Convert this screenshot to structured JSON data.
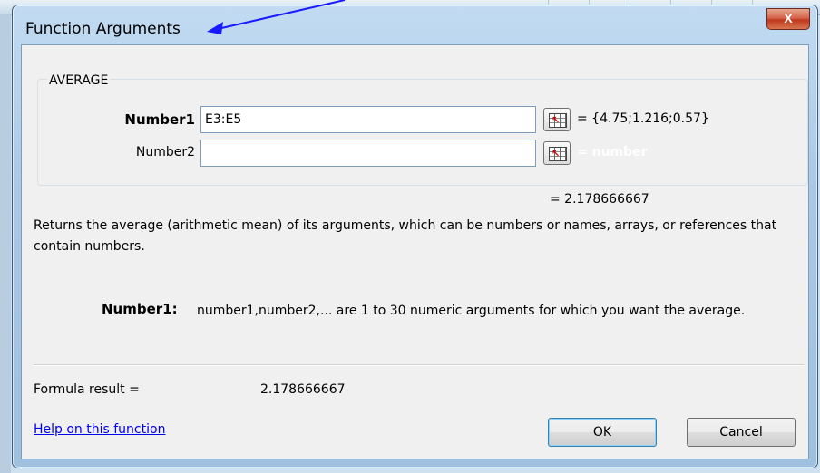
{
  "window": {
    "title": "Function Arguments",
    "close_label": "X"
  },
  "function": {
    "name": "AVERAGE"
  },
  "arguments": [
    {
      "label": "Number1",
      "value": "E3:E5",
      "evaluated": "= {4.75;1.216;0.57}"
    },
    {
      "label": "Number2",
      "value": "",
      "evaluated": "= number"
    }
  ],
  "result": {
    "line": "= 2.178666667"
  },
  "description": "Returns the average (arithmetic mean) of its arguments, which can be numbers or names, arrays, or references that contain numbers.",
  "argument_help": {
    "name": "Number1:",
    "text": "number1,number2,... are 1 to 30 numeric arguments for which you want the average."
  },
  "formula": {
    "label": "Formula result =",
    "value": "2.178666667"
  },
  "footer": {
    "help_link": "Help on this function",
    "ok_label": "OK",
    "cancel_label": "Cancel"
  },
  "colors": {
    "link": "#0000ee",
    "arrow": "#1a1aff",
    "close": "#c0381d"
  }
}
